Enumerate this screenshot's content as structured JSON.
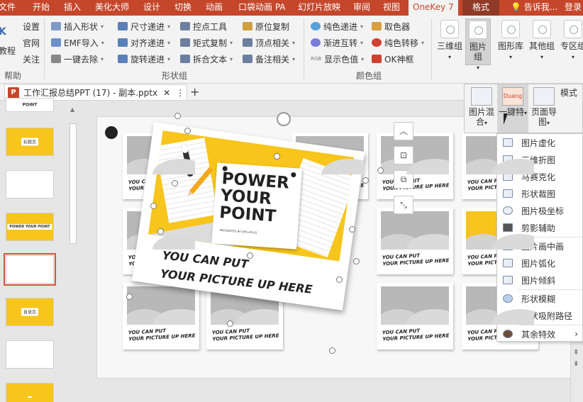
{
  "tabs": [
    "文件",
    "开始",
    "插入",
    "美化大师",
    "设计",
    "切换",
    "动画",
    "口袋动画 PA",
    "幻灯片放映",
    "审阅",
    "视图",
    "OneKey 7",
    "格式",
    "告诉我...",
    "登录"
  ],
  "colors": {
    "accent": "#c5472b",
    "yellow": "#f7c51b",
    "ribbon_bg": "#f3f3f3"
  },
  "ribbon": {
    "left_items": [
      "设置",
      "官网",
      "关注"
    ],
    "left_big": "教程",
    "help_label": "帮助",
    "shape_group": {
      "col1": [
        "插入形状",
        "EMF导入",
        "一键去除"
      ],
      "col2": [
        "尺寸递进",
        "对齐递进",
        "旋转递进"
      ],
      "col3": [
        "控点工具",
        "矩式复制",
        "拆合文本"
      ],
      "col4": [
        "原位复制",
        "顶点相关",
        "备注相关"
      ],
      "label": "形状组"
    },
    "color_group": {
      "col1": [
        "纯色递进",
        "渐进互转",
        "显示色值"
      ],
      "col2": [
        "取色器",
        "纯色转移",
        "OK神框"
      ],
      "label": "颜色组",
      "rgb_prefix": "RGB"
    },
    "big_buttons": [
      {
        "label": "三维组",
        "dd": "▾"
      },
      {
        "label": "图片组",
        "dd": "▾"
      },
      {
        "label": "图形库",
        "dd": "▾"
      },
      {
        "label": "其他组",
        "dd": "▾"
      },
      {
        "label": "专区组",
        "dd": "▾"
      }
    ]
  },
  "document": {
    "icon": "P",
    "name": "工作汇报总结PPT (17) - 副本.pptx",
    "close": "✕",
    "more": "⋮",
    "add": "+"
  },
  "thumbnails": [
    {
      "label": "POINT"
    },
    {
      "label": "标题页"
    },
    {
      "label": ""
    },
    {
      "label": "POWER YOUR POINT"
    },
    {
      "label": ""
    },
    {
      "label": "目录页"
    },
    {
      "label": ""
    },
    {
      "label": ""
    }
  ],
  "slide": {
    "small_caption": "YOU CAN PUT\nYOUR PICTURE UP HERE",
    "big_title": "POWER\nYOUR\nPOINT",
    "big_subtitle": "PRESENTED BY OfficePLUS",
    "big_caption": "YOU CAN PUT\nYOUR PICTURE UP HERE"
  },
  "float_toolbar": [
    "︿",
    "⊡",
    "⧉",
    "⤡"
  ],
  "dropdown_bar": [
    {
      "label": "图片混合",
      "dd": "▾"
    },
    {
      "label": "一键特",
      "dd": "▾",
      "badge": "Duang"
    },
    {
      "label": "页面导图",
      "dd": "▾"
    }
  ],
  "mode_label": "模式",
  "menu": [
    "图片虚化",
    "三维折图",
    "马赛克化",
    "形状裁图",
    "图片极坐标",
    "剪影辅助",
    "图片画中画",
    "图片弧化",
    "图片倾斜",
    "形状模糊",
    "形状吸附路径",
    "其余特效"
  ],
  "menu_arrow": "›",
  "scroll": {
    "up": "▲",
    "down": "▼",
    "page_up": "⇞",
    "page_down": "⇟"
  }
}
